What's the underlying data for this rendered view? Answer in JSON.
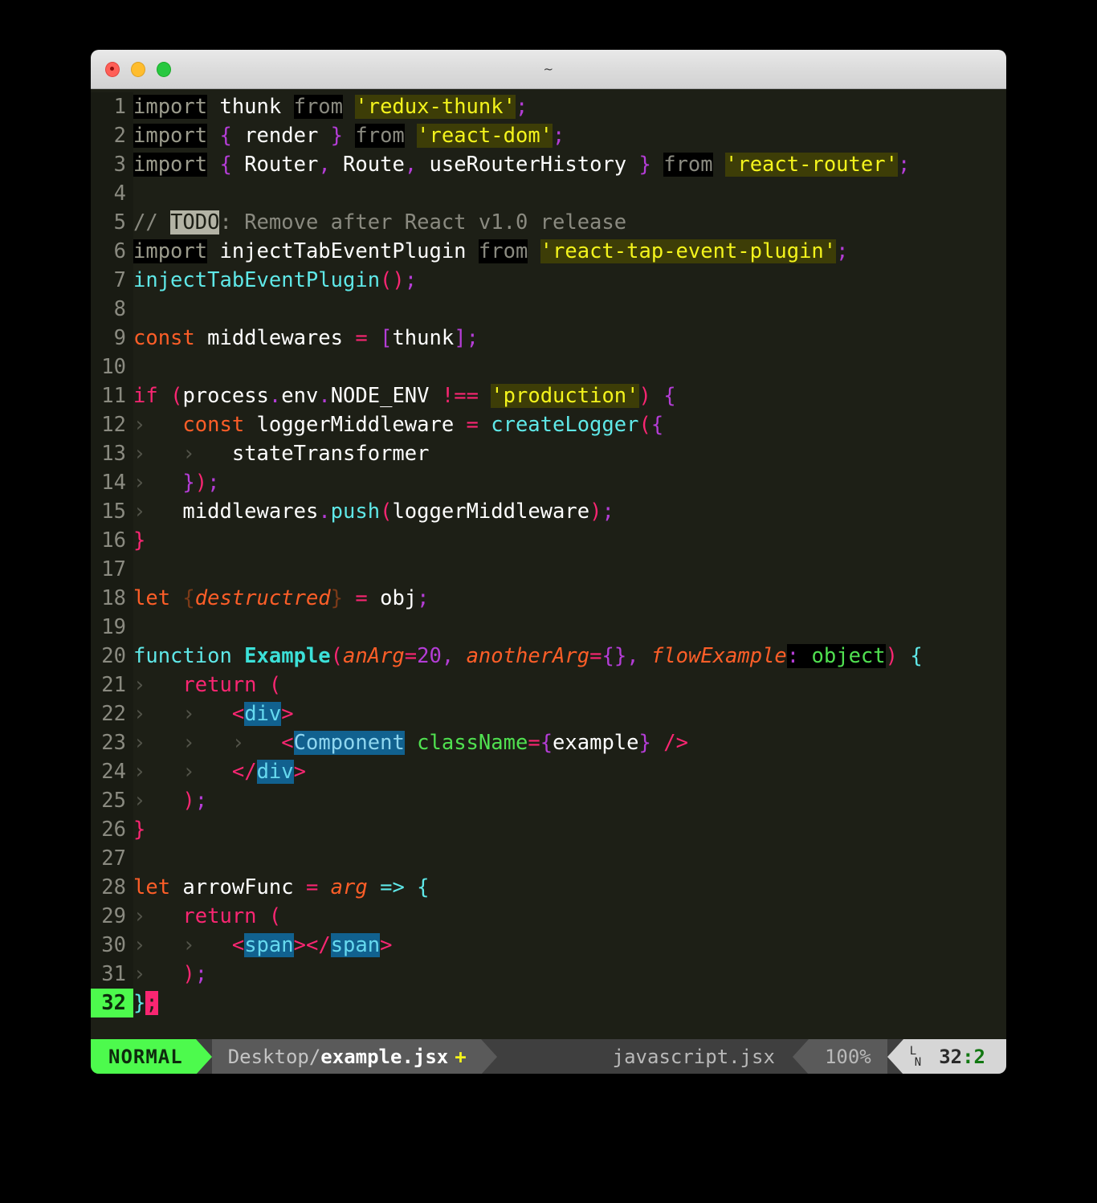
{
  "window": {
    "title": "~",
    "traffic_lights": [
      "close-red",
      "minimize-yellow",
      "maximize-green"
    ]
  },
  "editor": {
    "filetype": "javascript.jsx",
    "total_lines": 32,
    "lines": [
      {
        "n": "1",
        "text": "import thunk from 'redux-thunk';"
      },
      {
        "n": "2",
        "text": "import { render } from 'react-dom';"
      },
      {
        "n": "3",
        "text": "import { Router, Route, useRouterHistory } from 'react-router';"
      },
      {
        "n": "4",
        "text": ""
      },
      {
        "n": "5",
        "text": "// TODO: Remove after React v1.0 release"
      },
      {
        "n": "6",
        "text": "import injectTabEventPlugin from 'react-tap-event-plugin';"
      },
      {
        "n": "7",
        "text": "injectTabEventPlugin();"
      },
      {
        "n": "8",
        "text": ""
      },
      {
        "n": "9",
        "text": "const middlewares = [thunk];"
      },
      {
        "n": "10",
        "text": ""
      },
      {
        "n": "11",
        "text": "if (process.env.NODE_ENV !== 'production') {"
      },
      {
        "n": "12",
        "text": "    const loggerMiddleware = createLogger({"
      },
      {
        "n": "13",
        "text": "        stateTransformer"
      },
      {
        "n": "14",
        "text": "    });"
      },
      {
        "n": "15",
        "text": "    middlewares.push(loggerMiddleware);"
      },
      {
        "n": "16",
        "text": "}"
      },
      {
        "n": "17",
        "text": ""
      },
      {
        "n": "18",
        "text": "let {destructred} = obj;"
      },
      {
        "n": "19",
        "text": ""
      },
      {
        "n": "20",
        "text": "function Example(anArg=20, anotherArg={}, flowExample: object) {"
      },
      {
        "n": "21",
        "text": "    return ("
      },
      {
        "n": "22",
        "text": "        <div>"
      },
      {
        "n": "23",
        "text": "            <Component className={example} />"
      },
      {
        "n": "24",
        "text": "        </div>"
      },
      {
        "n": "25",
        "text": "    );"
      },
      {
        "n": "26",
        "text": "}"
      },
      {
        "n": "27",
        "text": ""
      },
      {
        "n": "28",
        "text": "let arrowFunc = arg => {"
      },
      {
        "n": "29",
        "text": "    return ("
      },
      {
        "n": "30",
        "text": "        <span></span>"
      },
      {
        "n": "31",
        "text": "    );"
      },
      {
        "n": "32",
        "text": "};"
      }
    ]
  },
  "statusbar": {
    "mode": "NORMAL",
    "file_dir": "Desktop/",
    "file_name": "example.jsx",
    "modified_flag": "+",
    "filetype": "javascript.jsx",
    "percent": "100%",
    "ln_glyph_top": "L",
    "ln_glyph_bottom": "N",
    "position_line": "32",
    "position_sep": ":",
    "position_col": "2"
  },
  "tokens": {
    "l1_import": "import",
    "l1_thunk": " thunk ",
    "l1_from": "from",
    "l1_str": "'redux-thunk'",
    "l1_semi": ";",
    "l2_import": "import",
    "l2_ob": " { ",
    "l2_render": "render",
    "l2_cb": " } ",
    "l2_from": "from",
    "l2_str": "'react-dom'",
    "l2_semi": ";",
    "l3_import": "import",
    "l3_ob": " { ",
    "l3_router": "Router",
    "l3_c1": ", ",
    "l3_route": "Route",
    "l3_c2": ", ",
    "l3_hist": "useRouterHistory",
    "l3_cb": " } ",
    "l3_from": "from",
    "l3_str": "'react-router'",
    "l3_semi": ";",
    "l5_slashes": "// ",
    "l5_todo": "TODO",
    "l5_rest": ": Remove after React v1.0 release",
    "l6_import": "import",
    "l6_name": " injectTabEventPlugin ",
    "l6_from": "from",
    "l6_str": "'react-tap-event-plugin'",
    "l6_semi": ";",
    "l7_name": "injectTabEventPlugin",
    "l7_parens": "()",
    "l7_semi": ";",
    "l9_const": "const",
    "l9_name": " middlewares ",
    "l9_eq": "=",
    "l9_ob": " [",
    "l9_thunk": "thunk",
    "l9_cb": "]",
    "l9_semi": ";",
    "l11_if": "if",
    "l11_op": " (",
    "l11_process": "process",
    "l11_d1": ".",
    "l11_env": "env",
    "l11_d2": ".",
    "l11_node": "NODE_ENV",
    "l11_neq": " !== ",
    "l11_str": "'production'",
    "l11_cp": ")",
    "l11_brace": " {",
    "l12_const": "const",
    "l12_name": " loggerMiddleware ",
    "l12_eq": "=",
    "l12_fn": " createLogger",
    "l12_op": "(",
    "l12_ob": "{",
    "l13_name": "stateTransformer",
    "l14_cb": "}",
    "l14_cp": ")",
    "l14_semi": ";",
    "l15_obj": "middlewares",
    "l15_dot": ".",
    "l15_fn": "push",
    "l15_op": "(",
    "l15_arg": "loggerMiddleware",
    "l15_cp": ")",
    "l15_semi": ";",
    "l16_cb": "}",
    "l18_let": "let",
    "l18_ob": " {",
    "l18_name": "destructred",
    "l18_cb": "}",
    "l18_eq": " = ",
    "l18_obj": "obj",
    "l18_semi": ";",
    "l20_function": "function",
    "l20_name": " Example",
    "l20_op": "(",
    "l20_a1": "anArg",
    "l20_eq1": "=",
    "l20_v1": "20",
    "l20_c1": ", ",
    "l20_a2": "anotherArg",
    "l20_eq2": "=",
    "l20_v2": "{}",
    "l20_c2": ", ",
    "l20_a3": "flowExample",
    "l20_colon": ":",
    "l20_type": " object",
    "l20_cp": ")",
    "l20_brace": " {",
    "l21_return": "return",
    "l21_op": " (",
    "l22_lt": "<",
    "l22_tag": "div",
    "l22_gt": ">",
    "l23_lt": "<",
    "l23_tag": "Component",
    "l23_attr": " className",
    "l23_eq": "=",
    "l23_ob": "{",
    "l23_val": "example",
    "l23_cb": "}",
    "l23_close": " />",
    "l24_lt": "</",
    "l24_tag": "div",
    "l24_gt": ">",
    "l25_cp": ")",
    "l25_semi": ";",
    "l26_cb": "}",
    "l28_let": "let",
    "l28_name": " arrowFunc ",
    "l28_eq": "=",
    "l28_arg": " arg",
    "l28_arrow": " => ",
    "l28_brace": "{",
    "l29_return": "return",
    "l29_op": " (",
    "l30_lt": "<",
    "l30_tag": "span",
    "l30_gt": ">",
    "l30_lt2": "</",
    "l30_tag2": "span",
    "l30_gt2": ">",
    "l31_cp": ")",
    "l31_semi": ";",
    "l32_cb": "}",
    "l32_semi": ";",
    "indent_guide": "›"
  },
  "colors": {
    "background": "#1d1f16",
    "gutter": "#191b13",
    "string": "#f4f41c",
    "string_bg": "#3d3d07",
    "keyword_pink": "#f92672",
    "keyword_orange": "#fd5e28",
    "function_cyan": "#5fe8e8",
    "jsx_tag_bg": "#11618f",
    "cursor": "#f92672",
    "mode_green": "#4dfa4d"
  }
}
